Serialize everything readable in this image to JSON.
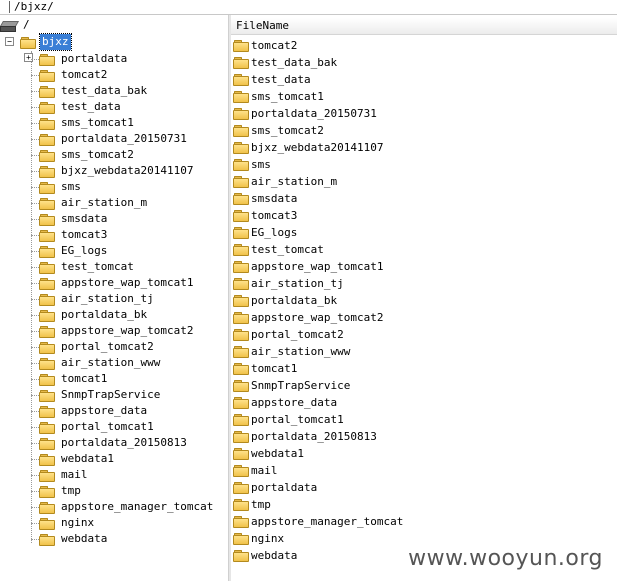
{
  "path_bar": {
    "path": "/bjxz/"
  },
  "tree": {
    "root_label": "/",
    "selected_label": "bjxz",
    "children": [
      "portaldata",
      "tomcat2",
      "test_data_bak",
      "test_data",
      "sms_tomcat1",
      "portaldata_20150731",
      "sms_tomcat2",
      "bjxz_webdata20141107",
      "sms",
      "air_station_m",
      "smsdata",
      "tomcat3",
      "EG_logs",
      "test_tomcat",
      "appstore_wap_tomcat1",
      "air_station_tj",
      "portaldata_bk",
      "appstore_wap_tomcat2",
      "portal_tomcat2",
      "air_station_www",
      "tomcat1",
      "SnmpTrapService",
      "appstore_data",
      "portal_tomcat1",
      "portaldata_20150813",
      "webdata1",
      "mail",
      "tmp",
      "appstore_manager_tomcat",
      "nginx",
      "webdata"
    ]
  },
  "file_list": {
    "column_header": "FileName",
    "rows": [
      "tomcat2",
      "test_data_bak",
      "test_data",
      "sms_tomcat1",
      "portaldata_20150731",
      "sms_tomcat2",
      "bjxz_webdata20141107",
      "sms",
      "air_station_m",
      "smsdata",
      "tomcat3",
      "EG_logs",
      "test_tomcat",
      "appstore_wap_tomcat1",
      "air_station_tj",
      "portaldata_bk",
      "appstore_wap_tomcat2",
      "portal_tomcat2",
      "air_station_www",
      "tomcat1",
      "SnmpTrapService",
      "appstore_data",
      "portal_tomcat1",
      "portaldata_20150813",
      "webdata1",
      "mail",
      "portaldata",
      "tmp",
      "appstore_manager_tomcat",
      "nginx",
      "webdata"
    ]
  },
  "watermark": "www.wooyun.org",
  "colors": {
    "selection": "#3a7fd6",
    "folder": "#f0c24a"
  }
}
